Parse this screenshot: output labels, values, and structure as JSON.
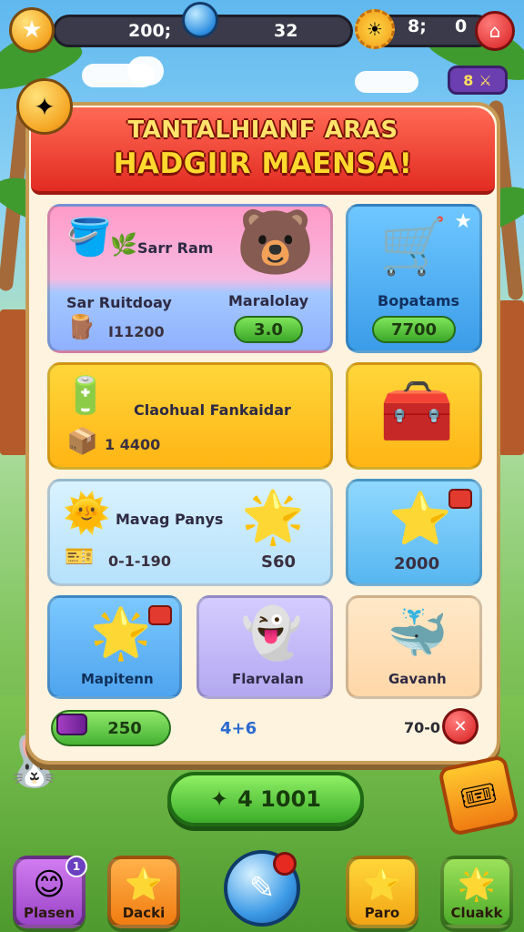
{
  "topbar": {
    "currency1": "200;",
    "currency2": "32",
    "currency3": "8;",
    "currency4": "0"
  },
  "swords_badge": {
    "value": "8"
  },
  "panel": {
    "title_line1": "TANTALHIANF ARAS",
    "title_line2": "HADGIIR MAENSA!"
  },
  "cards": [
    {
      "title": "Sarr Ram",
      "subtitle": "Sar Ruitdoay",
      "subtitle2": "Maralolay",
      "price": "I11200",
      "button": "3.0"
    },
    {
      "title": "Bopatams",
      "button": "7700"
    },
    {
      "title": "Claohual Fankaidar",
      "price": "1 4400"
    },
    {
      "title": ""
    },
    {
      "title": "Mavag Panys",
      "price": "0-1-190",
      "button": "S60"
    },
    {
      "title": "",
      "button": "2000"
    },
    {
      "title": "Mapitenn"
    },
    {
      "title": "Flarvalan"
    },
    {
      "title": "Gavanh"
    }
  ],
  "bottom_row": {
    "battery_value": "250",
    "middle_value": "4+6",
    "right_value": "70-0"
  },
  "main_button": {
    "label": "4 1001"
  },
  "nav": [
    {
      "label": "Plasen",
      "icon": "face-icon",
      "badge": "1"
    },
    {
      "label": "Dacki",
      "icon": "star-icon"
    },
    {
      "label": "",
      "icon": "orb-icon"
    },
    {
      "label": "Paro",
      "icon": "star-icon"
    },
    {
      "label": "Cluakk",
      "icon": "star-icon"
    }
  ],
  "colors": {
    "panel_bg": "#fdf3df",
    "banner_red": "#e22b22",
    "button_green": "#3cad2a",
    "title_yellow": "#ffd92e"
  }
}
